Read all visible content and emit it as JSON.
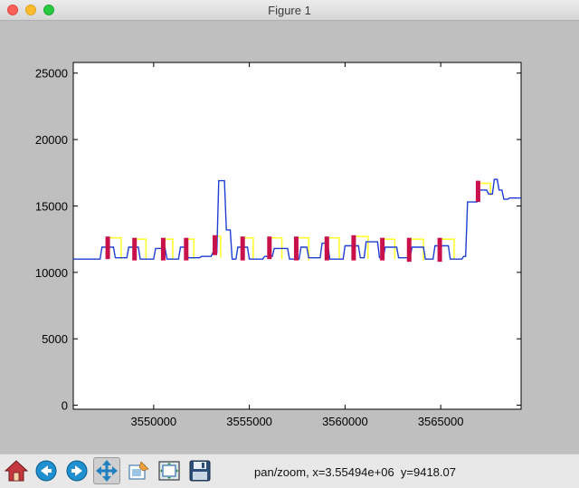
{
  "window": {
    "title": "Figure 1"
  },
  "toolbar": {
    "tools": [
      {
        "name": "home-icon"
      },
      {
        "name": "back-arrow-icon"
      },
      {
        "name": "forward-arrow-icon"
      },
      {
        "name": "pan-move-icon",
        "active": true
      },
      {
        "name": "zoom-rect-icon"
      },
      {
        "name": "subplots-config-icon"
      },
      {
        "name": "save-floppy-icon"
      }
    ],
    "status": "pan/zoom, x=3.55494e+06  y=9418.07"
  },
  "colors": {
    "line": "#1f3fd4",
    "step": "#ffff33",
    "bar": "#c8104a"
  },
  "chart_data": {
    "type": "line",
    "title": "",
    "xlabel": "",
    "ylabel": "",
    "xlim": [
      3545800,
      3569200
    ],
    "ylim": [
      -300,
      25800
    ],
    "yticks": [
      0,
      5000,
      10000,
      15000,
      20000,
      25000
    ],
    "ytick_labels": [
      "0",
      "5000",
      "10000",
      "15000",
      "20000",
      "25000"
    ],
    "xticks": [
      3550000,
      3555000,
      3560000,
      3565000
    ],
    "xtick_labels": [
      "3550000",
      "3555000",
      "3560000",
      "3565000"
    ],
    "grid": false,
    "series": [
      {
        "kind": "line",
        "x": [
          3545800,
          3547200,
          3547300,
          3547900,
          3548000,
          3548600,
          3548700,
          3549200,
          3549300,
          3550000,
          3550100,
          3550600,
          3550700,
          3551300,
          3551400,
          3551700,
          3551800,
          3552400,
          3552500,
          3553000,
          3553100,
          3553300,
          3553400,
          3553700,
          3553800,
          3554000,
          3554100,
          3554300,
          3554400,
          3554900,
          3555000,
          3555700,
          3555800,
          3556200,
          3556300,
          3557000,
          3557100,
          3557600,
          3557700,
          3558000,
          3558100,
          3558700,
          3558800,
          3559100,
          3559200,
          3559900,
          3560000,
          3560700,
          3560800,
          3561000,
          3561100,
          3561700,
          3561800,
          3562000,
          3562100,
          3562700,
          3562800,
          3563400,
          3563500,
          3564100,
          3564200,
          3564600,
          3564700,
          3565400,
          3565500,
          3566100,
          3566200,
          3566300,
          3566400,
          3566900,
          3567000,
          3567400,
          3567500,
          3567700,
          3567800,
          3567950,
          3568050,
          3568200,
          3568300,
          3568500,
          3568600,
          3569200
        ],
        "y": [
          11000,
          11000,
          11900,
          11900,
          11100,
          11100,
          11900,
          11900,
          11000,
          11000,
          11800,
          11800,
          11000,
          11000,
          11900,
          11900,
          11100,
          11100,
          11200,
          11200,
          11500,
          11500,
          16900,
          16900,
          13200,
          13200,
          11000,
          11000,
          11900,
          11900,
          11000,
          11000,
          11200,
          11200,
          11800,
          11800,
          11000,
          11000,
          11900,
          11900,
          11100,
          11100,
          12200,
          12200,
          11000,
          11000,
          12000,
          12000,
          11100,
          11100,
          12300,
          12300,
          11100,
          11100,
          11900,
          11900,
          11100,
          11100,
          11900,
          11900,
          11000,
          11000,
          12000,
          12000,
          11000,
          11000,
          11200,
          11200,
          15300,
          15300,
          16200,
          16200,
          15900,
          15900,
          17000,
          17000,
          16200,
          16200,
          15500,
          15500,
          15600,
          15600
        ]
      },
      {
        "kind": "yellow-step-segments",
        "segments": [
          {
            "x0": 3547500,
            "x1": 3548300,
            "y0": 12600,
            "y1": 11000
          },
          {
            "x0": 3548900,
            "x1": 3549600,
            "y0": 12500,
            "y1": 11000
          },
          {
            "x0": 3550400,
            "x1": 3551000,
            "y0": 12500,
            "y1": 11000
          },
          {
            "x0": 3551600,
            "x1": 3552100,
            "y0": 12500,
            "y1": 11000
          },
          {
            "x0": 3553100,
            "x1": 3553500,
            "y0": 12700,
            "y1": 11100
          },
          {
            "x0": 3554600,
            "x1": 3555200,
            "y0": 12600,
            "y1": 11000
          },
          {
            "x0": 3556000,
            "x1": 3556700,
            "y0": 12600,
            "y1": 11000
          },
          {
            "x0": 3557400,
            "x1": 3558100,
            "y0": 12600,
            "y1": 10900
          },
          {
            "x0": 3559000,
            "x1": 3559700,
            "y0": 12600,
            "y1": 11000
          },
          {
            "x0": 3560400,
            "x1": 3561200,
            "y0": 12700,
            "y1": 11000
          },
          {
            "x0": 3561900,
            "x1": 3562600,
            "y0": 12500,
            "y1": 11000
          },
          {
            "x0": 3563300,
            "x1": 3564100,
            "y0": 12500,
            "y1": 10900
          },
          {
            "x0": 3564900,
            "x1": 3565700,
            "y0": 12500,
            "y1": 11000
          },
          {
            "x0": 3566900,
            "x1": 3567600,
            "y0": 16700,
            "y1": 15800
          }
        ]
      },
      {
        "kind": "crimson-bars",
        "bars": [
          {
            "x": 3547600,
            "y0": 11000,
            "y1": 12700
          },
          {
            "x": 3549000,
            "y0": 10900,
            "y1": 12600
          },
          {
            "x": 3550500,
            "y0": 10900,
            "y1": 12600
          },
          {
            "x": 3551700,
            "y0": 10900,
            "y1": 12600
          },
          {
            "x": 3553200,
            "y0": 11300,
            "y1": 12800
          },
          {
            "x": 3554650,
            "y0": 10900,
            "y1": 12700
          },
          {
            "x": 3556050,
            "y0": 11000,
            "y1": 12700
          },
          {
            "x": 3557450,
            "y0": 10900,
            "y1": 12700
          },
          {
            "x": 3559050,
            "y0": 10900,
            "y1": 12700
          },
          {
            "x": 3560450,
            "y0": 10900,
            "y1": 12800
          },
          {
            "x": 3561950,
            "y0": 10900,
            "y1": 12600
          },
          {
            "x": 3563350,
            "y0": 10800,
            "y1": 12600
          },
          {
            "x": 3564950,
            "y0": 10800,
            "y1": 12600
          },
          {
            "x": 3566950,
            "y0": 15300,
            "y1": 16900
          }
        ]
      }
    ]
  }
}
